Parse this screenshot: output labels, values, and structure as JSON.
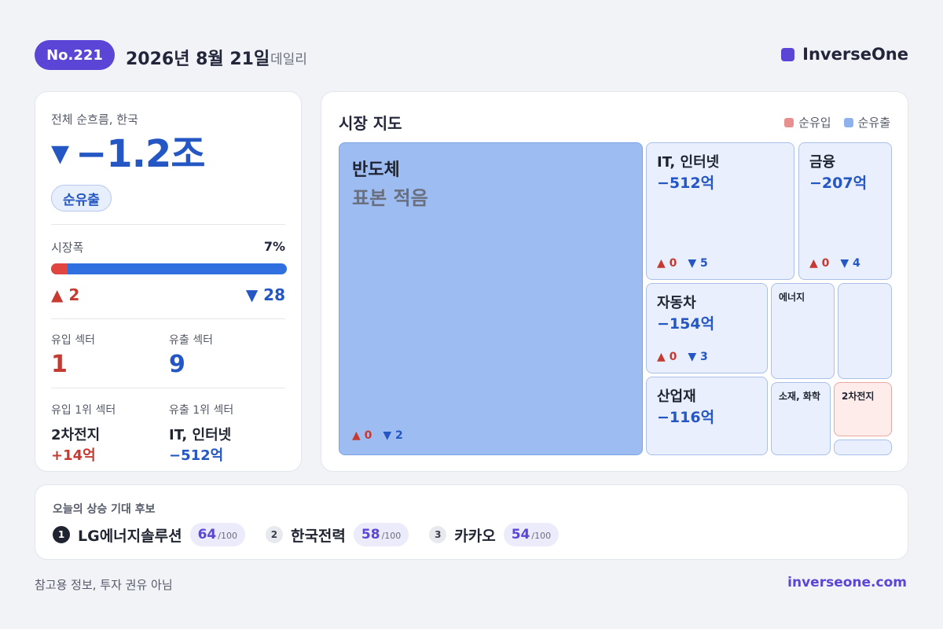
{
  "header": {
    "issue": "No.221",
    "date": "2026년 8월 21일",
    "period": "데일리",
    "brand": "InverseOne",
    "brand_color": "#5b45d6"
  },
  "summary": {
    "title": "전체 순흐름, 한국",
    "arrow": "▼",
    "total": "−1.2조",
    "flow_label": "순유출",
    "breadth_label": "시장폭",
    "breadth_pct_text": "7%",
    "breadth_fraction": 0.07,
    "up_count": "▲ 2",
    "down_count": "▼ 28",
    "inflow_sectors_label": "유입 섹터",
    "inflow_sectors": "1",
    "outflow_sectors_label": "유출 섹터",
    "outflow_sectors": "9",
    "top_inflow_label": "유입 1위 섹터",
    "top_inflow_name": "2차전지",
    "top_inflow_value": "+14억",
    "top_outflow_label": "유출 1위 섹터",
    "top_outflow_name": "IT, 인터넷",
    "top_outflow_value": "−512억"
  },
  "map": {
    "title": "시장 지도",
    "legend_in": "순유입",
    "legend_out": "순유출",
    "color_in": "#e88f8f",
    "color_out": "#8fb1ec",
    "tiles": {
      "semis": {
        "name": "반도체",
        "note": "표본 적음",
        "up": "▲ 0",
        "down": "▼ 2"
      },
      "it": {
        "name": "IT, 인터넷",
        "value": "−512억",
        "up": "▲ 0",
        "down": "▼ 5"
      },
      "finance": {
        "name": "금융",
        "value": "−207억",
        "up": "▲ 0",
        "down": "▼ 4"
      },
      "auto": {
        "name": "자동차",
        "value": "−154억",
        "up": "▲ 0",
        "down": "▼ 3"
      },
      "energy": {
        "name": "에너지"
      },
      "industrial": {
        "name": "산업재",
        "value": "−116억"
      },
      "materials": {
        "name": "소재, 화학"
      },
      "battery": {
        "name": "2차전지"
      }
    }
  },
  "candidates": {
    "title": "오늘의 상승 기대 후보",
    "max": "/100",
    "items": [
      {
        "rank": "1",
        "name": "LG에너지솔루션",
        "score": "64"
      },
      {
        "rank": "2",
        "name": "한국전력",
        "score": "58"
      },
      {
        "rank": "3",
        "name": "카카오",
        "score": "54"
      }
    ]
  },
  "footer": {
    "disclaimer": "참고용 정보, 투자 권유 아님",
    "site": "inverseone.com"
  }
}
